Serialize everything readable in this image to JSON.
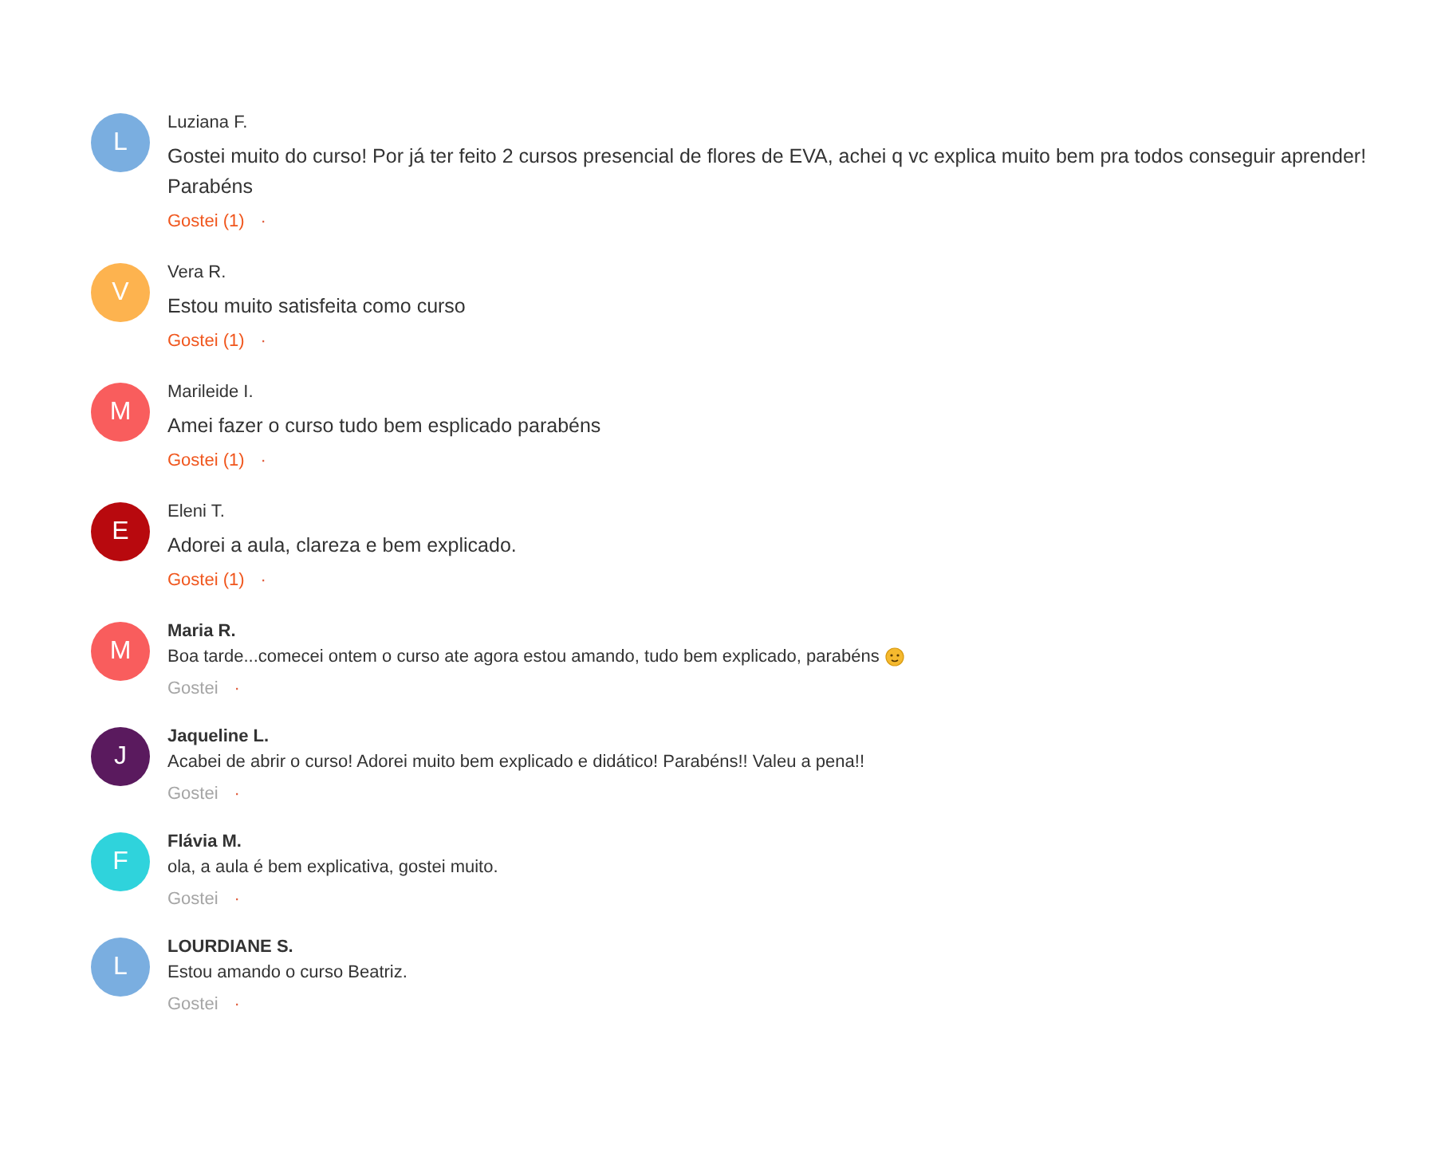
{
  "comments": [
    {
      "kind": "large",
      "initial": "L",
      "color": "#7aaee0",
      "name": "Luziana F.",
      "text": "Gostei muito do curso! Por já ter feito 2 cursos presencial de flores de EVA, achei q vc explica muito bem pra todos conseguir aprender! Parabéns",
      "like": "Gostei (1)",
      "liked": true,
      "separator": "·"
    },
    {
      "kind": "large",
      "initial": "V",
      "color": "#fdb34f",
      "name": "Vera R.",
      "text": "Estou muito satisfeita como curso",
      "like": "Gostei (1)",
      "liked": true,
      "separator": "·"
    },
    {
      "kind": "large",
      "initial": "M",
      "color": "#f95d5d",
      "name": "Marileide I.",
      "text": "Amei fazer o curso tudo bem esplicado parabéns",
      "like": "Gostei (1)",
      "liked": true,
      "separator": "·"
    },
    {
      "kind": "large",
      "initial": "E",
      "color": "#b8090e",
      "name": "Eleni T.",
      "text": "Adorei a aula, clareza e bem explicado.",
      "like": "Gostei (1)",
      "liked": true,
      "separator": "·"
    },
    {
      "kind": "compact",
      "initial": "M",
      "color": "#f95d5d",
      "name": "Maria R.",
      "text": "Boa tarde...comecei ontem o curso ate agora estou amando, tudo bem explicado, parabéns",
      "emoji": true,
      "like": "Gostei",
      "liked": false,
      "separator": "·"
    },
    {
      "kind": "compact",
      "initial": "J",
      "color": "#5a1a5e",
      "name": "Jaqueline L.",
      "text": "Acabei de abrir o curso! Adorei muito bem explicado e didático! Parabéns!! Valeu a pena!!",
      "like": "Gostei",
      "liked": false,
      "separator": "·"
    },
    {
      "kind": "compact",
      "initial": "F",
      "color": "#2fd3dc",
      "name": "Flávia M.",
      "text": "ola, a aula é bem explicativa, gostei muito.",
      "like": "Gostei",
      "liked": false,
      "separator": "·"
    },
    {
      "kind": "compact",
      "initial": "L",
      "color": "#7aaee0",
      "name": "LOURDIANE S.",
      "text": "Estou amando o curso Beatriz.",
      "like": "Gostei",
      "liked": false,
      "separator": "·"
    }
  ]
}
